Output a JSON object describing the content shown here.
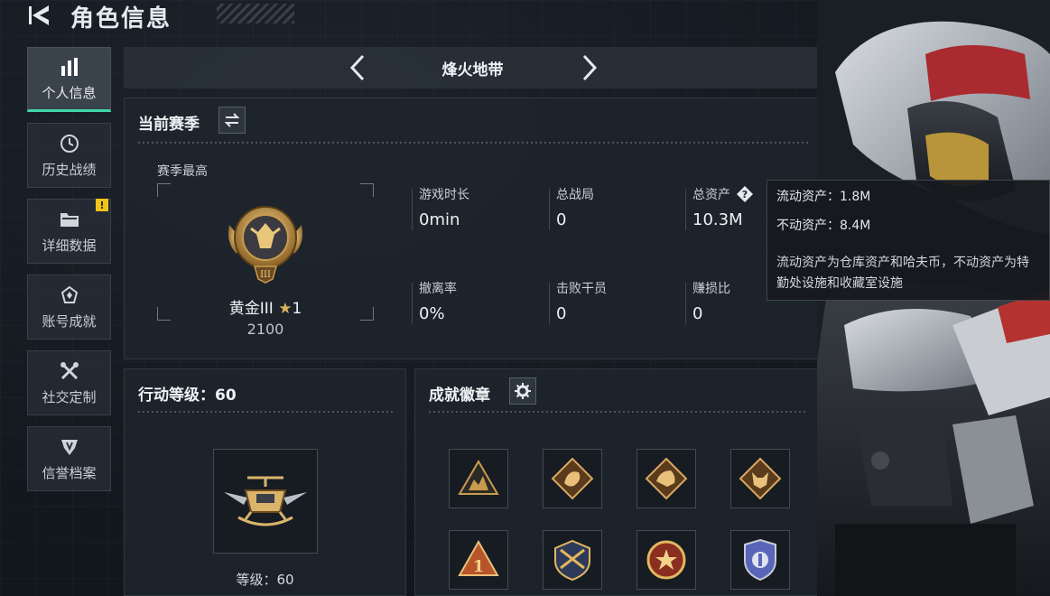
{
  "header": {
    "title": "角色信息"
  },
  "sidebar": {
    "items": [
      {
        "label": "个人信息",
        "icon": "bar-chart-icon",
        "active": true
      },
      {
        "label": "历史战绩",
        "icon": "clock-icon",
        "active": false
      },
      {
        "label": "详细数据",
        "icon": "folder-icon",
        "active": false,
        "badge": "!"
      },
      {
        "label": "账号成就",
        "icon": "achievement-icon",
        "active": false
      },
      {
        "label": "社交定制",
        "icon": "tools-icon",
        "active": false
      },
      {
        "label": "信誉档案",
        "icon": "credit-icon",
        "active": false
      }
    ]
  },
  "mode": {
    "title": "烽火地带"
  },
  "season": {
    "title": "当前赛季",
    "best_label": "赛季最高",
    "rank_name": "黄金III",
    "rank_star": "★",
    "rank_stars": "1",
    "rank_score": "2100",
    "stats": [
      {
        "label": "游戏时长",
        "value": "0min"
      },
      {
        "label": "总战局",
        "value": "0"
      },
      {
        "label": "总资产",
        "value": "10.3M"
      },
      {
        "label": "撤离率",
        "value": "0%"
      },
      {
        "label": "击败干员",
        "value": "0"
      },
      {
        "label": "赚损比",
        "value": "0"
      }
    ]
  },
  "tooltip": {
    "liquid": "流动资产：1.8M",
    "fixed": "不动资产：8.4M",
    "description": "流动资产为仓库资产和哈夫币，不动资产为特勤处设施和收藏室设施"
  },
  "level": {
    "title": "行动等级：60",
    "label": "等级：60"
  },
  "achievements": {
    "title": "成就徽章",
    "badges": [
      "tri-squad-badge-icon",
      "dragon-badge-icon",
      "beast-badge-icon",
      "wolf-badge-icon",
      "rank-one-badge-icon",
      "shield-rifle-badge-icon",
      "star-wreath-badge-icon",
      "police-badge-icon"
    ]
  },
  "colors": {
    "accent": "#3fd6a6",
    "gold": "#d8b25a",
    "alert": "#f0c419"
  }
}
